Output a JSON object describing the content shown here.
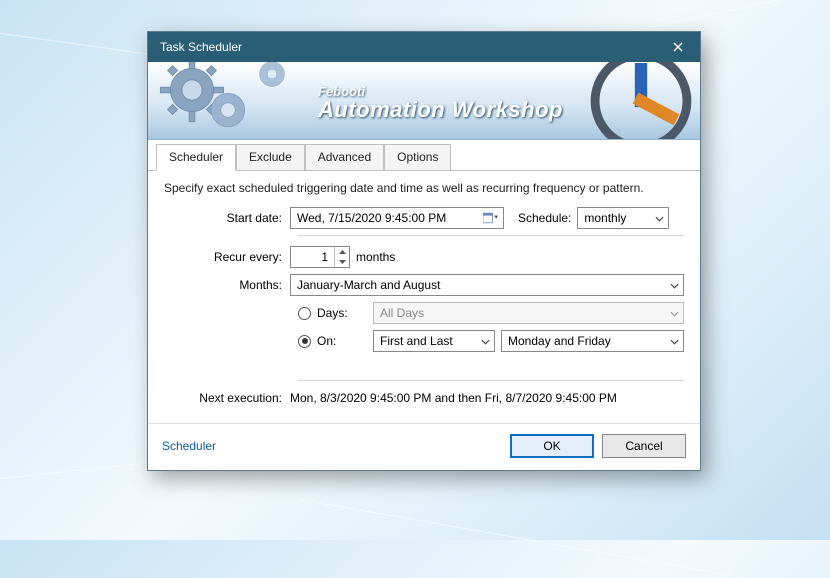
{
  "window": {
    "title": "Task Scheduler"
  },
  "banner": {
    "brand": "Febooti",
    "product": "Automation Workshop"
  },
  "tabs": [
    {
      "label": "Scheduler",
      "active": true
    },
    {
      "label": "Exclude"
    },
    {
      "label": "Advanced"
    },
    {
      "label": "Options"
    }
  ],
  "description": "Specify exact scheduled triggering date and time as well as recurring frequency or pattern.",
  "form": {
    "start_date_label": "Start date:",
    "start_date_value": "Wed,  7/15/2020  9:45:00 PM",
    "schedule_label": "Schedule:",
    "schedule_value": "monthly",
    "recur_label": "Recur every:",
    "recur_value": "1",
    "recur_unit": "months",
    "months_label": "Months:",
    "months_value": "January-March and August",
    "days_radio": {
      "label": "Days:",
      "checked": false,
      "value": "All Days"
    },
    "on_radio": {
      "label": "On:",
      "checked": true,
      "ordinal": "First and Last",
      "weekday": "Monday and Friday"
    },
    "next_label": "Next execution:",
    "next_value": "Mon, 8/3/2020 9:45:00 PM and then Fri, 8/7/2020 9:45:00 PM"
  },
  "footer": {
    "help_link": "Scheduler",
    "ok": "OK",
    "cancel": "Cancel"
  }
}
